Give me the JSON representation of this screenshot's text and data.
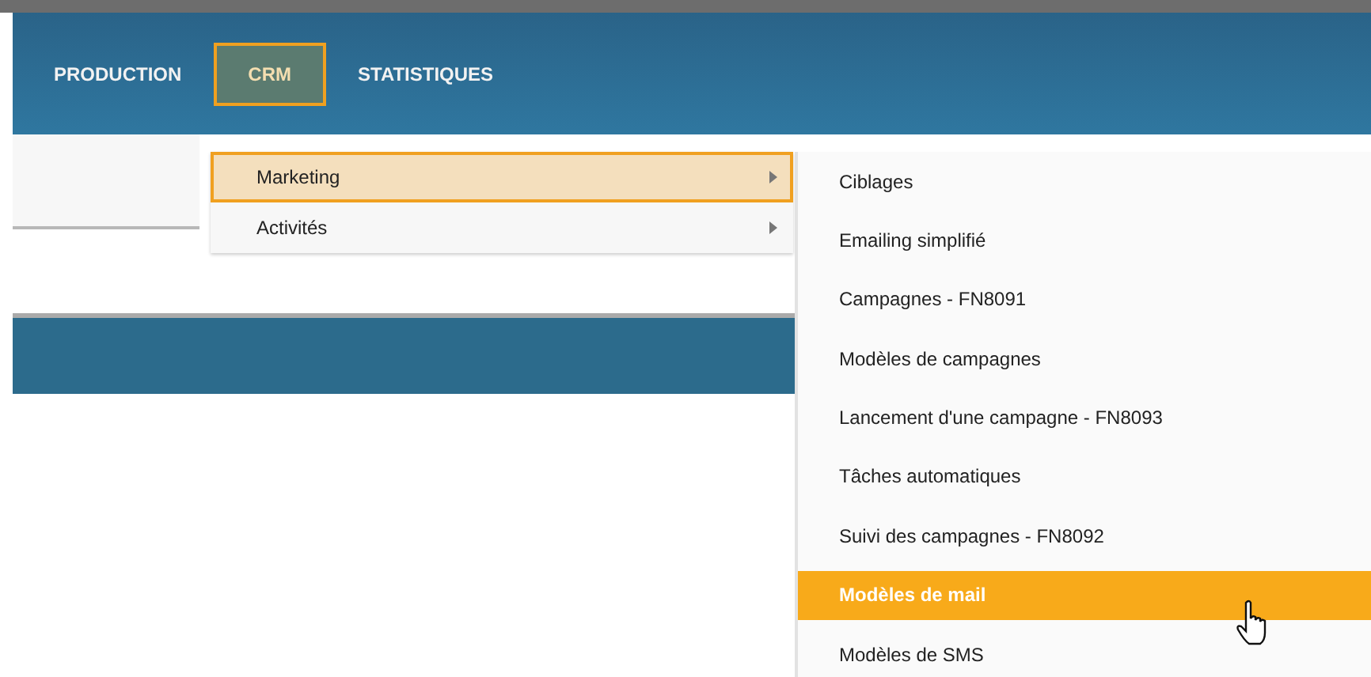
{
  "nav": [
    {
      "label": "PRODUCTION",
      "selected": false
    },
    {
      "label": "CRM",
      "selected": true
    },
    {
      "label": "STATISTIQUES",
      "selected": false
    }
  ],
  "menu": [
    {
      "label": "Marketing",
      "selected": true,
      "has_submenu": true
    },
    {
      "label": "Activités",
      "selected": false,
      "has_submenu": true
    }
  ],
  "submenu": [
    {
      "label": "Ciblages",
      "selected": false
    },
    {
      "label": "Emailing simplifié",
      "selected": false
    },
    {
      "label": "Campagnes - FN8091",
      "selected": false
    },
    {
      "label": "Modèles de campagnes",
      "selected": false
    },
    {
      "label": "Lancement d'une campagne - FN8093",
      "selected": false
    },
    {
      "label": "Tâches automatiques",
      "selected": false
    },
    {
      "label": "Suivi des campagnes - FN8092",
      "selected": false
    },
    {
      "label": "Modèles de mail",
      "selected": true
    },
    {
      "label": "Modèles de SMS",
      "selected": false
    }
  ]
}
